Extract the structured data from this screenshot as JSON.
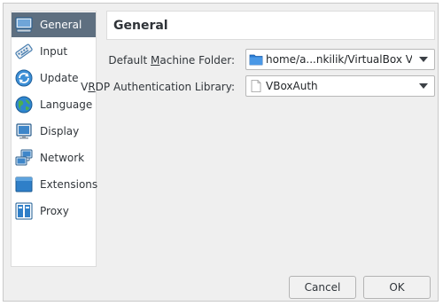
{
  "sidebar": {
    "items": [
      {
        "label": "General",
        "icon": "monitor-icon",
        "selected": true
      },
      {
        "label": "Input",
        "icon": "keyboard-icon"
      },
      {
        "label": "Update",
        "icon": "update-icon"
      },
      {
        "label": "Language",
        "icon": "globe-icon"
      },
      {
        "label": "Display",
        "icon": "display-icon"
      },
      {
        "label": "Network",
        "icon": "network-icon"
      },
      {
        "label": "Extensions",
        "icon": "extensions-icon"
      },
      {
        "label": "Proxy",
        "icon": "proxy-icon"
      }
    ]
  },
  "header": {
    "title": "General"
  },
  "form": {
    "machine_folder": {
      "label_pre": "Default ",
      "label_accel": "M",
      "label_post": "achine Folder:",
      "value": "home/a...nkilik/VirtualBox VMs"
    },
    "vrdp_library": {
      "label_pre": "V",
      "label_accel": "R",
      "label_post": "DP Authentication Library:",
      "value": "VBoxAuth"
    }
  },
  "buttons": {
    "cancel": "Cancel",
    "ok": "OK"
  },
  "colors": {
    "selection": "#5e6f80",
    "folder_blue": "#2a7bd4"
  }
}
